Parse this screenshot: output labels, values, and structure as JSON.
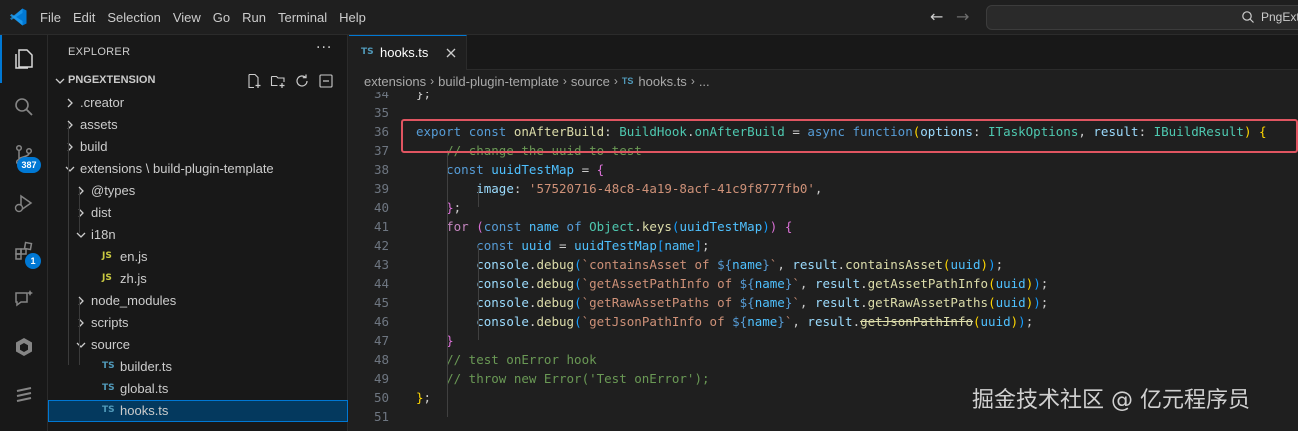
{
  "menu": [
    "File",
    "Edit",
    "Selection",
    "View",
    "Go",
    "Run",
    "Terminal",
    "Help"
  ],
  "command_center": {
    "text": "PngExt"
  },
  "activity_badges": {
    "source_control": "387",
    "extensions": "1"
  },
  "sidebar": {
    "title": "EXPLORER",
    "more": "···",
    "workspace": "PNGEXTENSION",
    "tree": [
      {
        "label": ".creator",
        "depth": 0,
        "kind": "folder"
      },
      {
        "label": "assets",
        "depth": 0,
        "kind": "folder"
      },
      {
        "label": "build",
        "depth": 0,
        "kind": "folder"
      },
      {
        "label": "extensions \\ build-plugin-template",
        "depth": 0,
        "kind": "folder-open"
      },
      {
        "label": "@types",
        "depth": 1,
        "kind": "folder"
      },
      {
        "label": "dist",
        "depth": 1,
        "kind": "folder"
      },
      {
        "label": "i18n",
        "depth": 1,
        "kind": "folder-open"
      },
      {
        "label": "en.js",
        "depth": 2,
        "kind": "js"
      },
      {
        "label": "zh.js",
        "depth": 2,
        "kind": "js"
      },
      {
        "label": "node_modules",
        "depth": 1,
        "kind": "folder"
      },
      {
        "label": "scripts",
        "depth": 1,
        "kind": "folder"
      },
      {
        "label": "source",
        "depth": 1,
        "kind": "folder-open"
      },
      {
        "label": "builder.ts",
        "depth": 2,
        "kind": "ts"
      },
      {
        "label": "global.ts",
        "depth": 2,
        "kind": "ts"
      },
      {
        "label": "hooks.ts",
        "depth": 2,
        "kind": "ts",
        "selected": true
      }
    ]
  },
  "tab": {
    "label": "hooks.ts",
    "icon": "TS"
  },
  "breadcrumbs": [
    "extensions",
    "build-plugin-template",
    "source",
    "hooks.ts",
    "..."
  ],
  "editor": {
    "lines": [
      {
        "n": "34",
        "tokens": [
          [
            "pn",
            "};"
          ]
        ]
      },
      {
        "n": "35",
        "tokens": []
      },
      {
        "n": "36",
        "tokens": [
          [
            "kw",
            "export "
          ],
          [
            "kw",
            "const "
          ],
          [
            "fn",
            "onAfterBuild"
          ],
          [
            "pn",
            ": "
          ],
          [
            "ty",
            "BuildHook"
          ],
          [
            "pn",
            "."
          ],
          [
            "ty",
            "onAfterBuild"
          ],
          [
            "pn",
            " = "
          ],
          [
            "kw",
            "async "
          ],
          [
            "kw",
            "function"
          ],
          [
            "br1",
            "("
          ],
          [
            "var",
            "options"
          ],
          [
            "pn",
            ": "
          ],
          [
            "ty",
            "ITaskOptions"
          ],
          [
            "pn",
            ", "
          ],
          [
            "var",
            "result"
          ],
          [
            "pn",
            ": "
          ],
          [
            "ty",
            "IBuildResult"
          ],
          [
            "br1",
            ")"
          ],
          [
            "pn",
            " "
          ],
          [
            "br1",
            "{"
          ]
        ]
      },
      {
        "n": "37",
        "tokens": [
          [
            "cm",
            "    // change the uuid to test"
          ]
        ]
      },
      {
        "n": "38",
        "tokens": [
          [
            "pn",
            "    "
          ],
          [
            "kw",
            "const "
          ],
          [
            "cst",
            "uuidTestMap"
          ],
          [
            "pn",
            " = "
          ],
          [
            "br2",
            "{"
          ]
        ]
      },
      {
        "n": "39",
        "tokens": [
          [
            "pn",
            "        "
          ],
          [
            "var",
            "image"
          ],
          [
            "pn",
            ": "
          ],
          [
            "str",
            "'57520716-48c8-4a19-8acf-41c9f8777fb0'"
          ],
          [
            "pn",
            ","
          ]
        ]
      },
      {
        "n": "40",
        "tokens": [
          [
            "pn",
            "    "
          ],
          [
            "br2",
            "}"
          ],
          [
            "pn",
            ";"
          ]
        ]
      },
      {
        "n": "41",
        "tokens": [
          [
            "pn",
            "    "
          ],
          [
            "ctl",
            "for "
          ],
          [
            "br2",
            "("
          ],
          [
            "kw",
            "const "
          ],
          [
            "cst",
            "name "
          ],
          [
            "kw",
            "of "
          ],
          [
            "ty",
            "Object"
          ],
          [
            "pn",
            "."
          ],
          [
            "fn",
            "keys"
          ],
          [
            "br3",
            "("
          ],
          [
            "cst",
            "uuidTestMap"
          ],
          [
            "br3",
            ")"
          ],
          [
            "br2",
            ")"
          ],
          [
            "pn",
            " "
          ],
          [
            "br2",
            "{"
          ]
        ]
      },
      {
        "n": "42",
        "tokens": [
          [
            "pn",
            "        "
          ],
          [
            "kw",
            "const "
          ],
          [
            "cst",
            "uuid"
          ],
          [
            "pn",
            " = "
          ],
          [
            "cst",
            "uuidTestMap"
          ],
          [
            "br3",
            "["
          ],
          [
            "cst",
            "name"
          ],
          [
            "br3",
            "]"
          ],
          [
            "pn",
            ";"
          ]
        ]
      },
      {
        "n": "43",
        "tokens": [
          [
            "pn",
            "        "
          ],
          [
            "var",
            "console"
          ],
          [
            "pn",
            "."
          ],
          [
            "fn",
            "debug"
          ],
          [
            "br3",
            "("
          ],
          [
            "str",
            "`containsAsset of "
          ],
          [
            "kw",
            "${"
          ],
          [
            "cst",
            "name"
          ],
          [
            "kw",
            "}"
          ],
          [
            "str",
            "`"
          ],
          [
            "pn",
            ", "
          ],
          [
            "var",
            "result"
          ],
          [
            "pn",
            "."
          ],
          [
            "fn",
            "containsAsset"
          ],
          [
            "br1",
            "("
          ],
          [
            "cst",
            "uuid"
          ],
          [
            "br1",
            ")"
          ],
          [
            "br3",
            ")"
          ],
          [
            "pn",
            ";"
          ]
        ]
      },
      {
        "n": "44",
        "tokens": [
          [
            "pn",
            "        "
          ],
          [
            "var",
            "console"
          ],
          [
            "pn",
            "."
          ],
          [
            "fn",
            "debug"
          ],
          [
            "br3",
            "("
          ],
          [
            "str",
            "`getAssetPathInfo of "
          ],
          [
            "kw",
            "${"
          ],
          [
            "cst",
            "name"
          ],
          [
            "kw",
            "}"
          ],
          [
            "str",
            "`"
          ],
          [
            "pn",
            ", "
          ],
          [
            "var",
            "result"
          ],
          [
            "pn",
            "."
          ],
          [
            "fn",
            "getAssetPathInfo"
          ],
          [
            "br1",
            "("
          ],
          [
            "cst",
            "uuid"
          ],
          [
            "br1",
            ")"
          ],
          [
            "br3",
            ")"
          ],
          [
            "pn",
            ";"
          ]
        ]
      },
      {
        "n": "45",
        "tokens": [
          [
            "pn",
            "        "
          ],
          [
            "var",
            "console"
          ],
          [
            "pn",
            "."
          ],
          [
            "fn",
            "debug"
          ],
          [
            "br3",
            "("
          ],
          [
            "str",
            "`getRawAssetPaths of "
          ],
          [
            "kw",
            "${"
          ],
          [
            "cst",
            "name"
          ],
          [
            "kw",
            "}"
          ],
          [
            "str",
            "`"
          ],
          [
            "pn",
            ", "
          ],
          [
            "var",
            "result"
          ],
          [
            "pn",
            "."
          ],
          [
            "fn",
            "getRawAssetPaths"
          ],
          [
            "br1",
            "("
          ],
          [
            "cst",
            "uuid"
          ],
          [
            "br1",
            ")"
          ],
          [
            "br3",
            ")"
          ],
          [
            "pn",
            ";"
          ]
        ]
      },
      {
        "n": "46",
        "tokens": [
          [
            "pn",
            "        "
          ],
          [
            "var",
            "console"
          ],
          [
            "pn",
            "."
          ],
          [
            "fn",
            "debug"
          ],
          [
            "br3",
            "("
          ],
          [
            "str",
            "`getJsonPathInfo of "
          ],
          [
            "kw",
            "${"
          ],
          [
            "cst",
            "name"
          ],
          [
            "kw",
            "}"
          ],
          [
            "str",
            "`"
          ],
          [
            "pn",
            ", "
          ],
          [
            "var",
            "result"
          ],
          [
            "pn",
            "."
          ],
          [
            "fn strike",
            "getJsonPathInfo"
          ],
          [
            "br1",
            "("
          ],
          [
            "cst",
            "uuid"
          ],
          [
            "br1",
            ")"
          ],
          [
            "br3",
            ")"
          ],
          [
            "pn",
            ";"
          ]
        ]
      },
      {
        "n": "47",
        "tokens": [
          [
            "pn",
            "    "
          ],
          [
            "br2",
            "}"
          ]
        ]
      },
      {
        "n": "48",
        "tokens": [
          [
            "cm",
            "    // test onError hook"
          ]
        ]
      },
      {
        "n": "49",
        "tokens": [
          [
            "cm",
            "    // throw new Error('Test onError');"
          ]
        ]
      },
      {
        "n": "50",
        "tokens": [
          [
            "br1",
            "}"
          ],
          [
            "pn",
            ";"
          ]
        ]
      },
      {
        "n": "51",
        "tokens": []
      }
    ]
  },
  "watermark": "掘金技术社区 @ 亿元程序员",
  "colors": {
    "accent": "#0078d4",
    "highlight_box": "#e05561"
  }
}
